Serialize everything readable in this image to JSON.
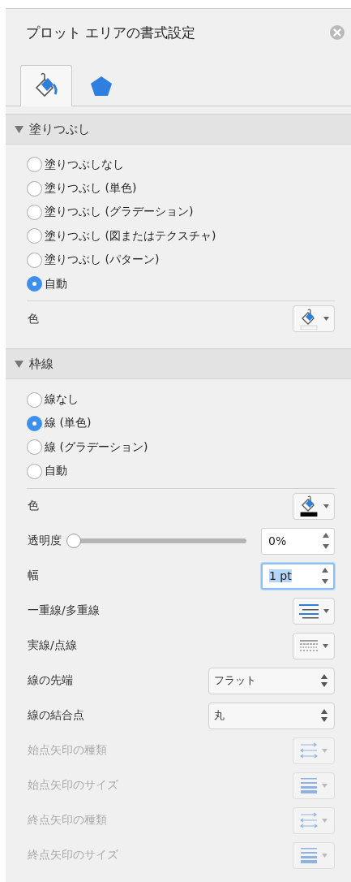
{
  "panel": {
    "title": "プロット エリアの書式設定"
  },
  "tabs": [
    {
      "kind": "fill",
      "selected": true
    },
    {
      "kind": "shape",
      "selected": false
    }
  ],
  "sections": [
    {
      "title": "塗りつぶし",
      "expanded": true,
      "options": [
        {
          "label": "塗りつぶしなし",
          "selected": false
        },
        {
          "label": "塗りつぶし (単色)",
          "selected": false
        },
        {
          "label": "塗りつぶし (グラデーション)",
          "selected": false
        },
        {
          "label": "塗りつぶし (図またはテクスチャ)",
          "selected": false
        },
        {
          "label": "塗りつぶし (パターン)",
          "selected": false
        },
        {
          "label": "自動",
          "selected": true
        }
      ],
      "rows": [
        {
          "kind": "color",
          "label": "色",
          "disabled": false
        }
      ]
    },
    {
      "title": "枠線",
      "expanded": true,
      "options": [
        {
          "label": "線なし",
          "selected": false
        },
        {
          "label": "線 (単色)",
          "selected": true
        },
        {
          "label": "線 (グラデーション)",
          "selected": false
        },
        {
          "label": "自動",
          "selected": false
        }
      ],
      "rows": [
        {
          "kind": "color",
          "label": "色",
          "color": "#000000",
          "disabled": false
        },
        {
          "kind": "slider",
          "label": "透明度",
          "level": 0,
          "value": "0%",
          "disabled": false
        },
        {
          "kind": "spin",
          "label": "幅",
          "value": "1 pt",
          "focused": true,
          "disabled": false
        },
        {
          "kind": "compound",
          "label": "一重線/多重線",
          "disabled": false
        },
        {
          "kind": "dash",
          "label": "実線/点線",
          "disabled": false
        },
        {
          "kind": "select",
          "label": "線の先端",
          "value": "フラット",
          "disabled": false
        },
        {
          "kind": "select",
          "label": "線の結合点",
          "value": "丸",
          "disabled": false
        },
        {
          "kind": "arrow-type",
          "label": "始点矢印の種類",
          "disabled": true
        },
        {
          "kind": "arrow-size",
          "label": "始点矢印のサイズ",
          "disabled": true
        },
        {
          "kind": "arrow-type",
          "label": "終点矢印の種類",
          "disabled": true
        },
        {
          "kind": "arrow-size",
          "label": "終点矢印のサイズ",
          "disabled": true
        }
      ]
    }
  ]
}
